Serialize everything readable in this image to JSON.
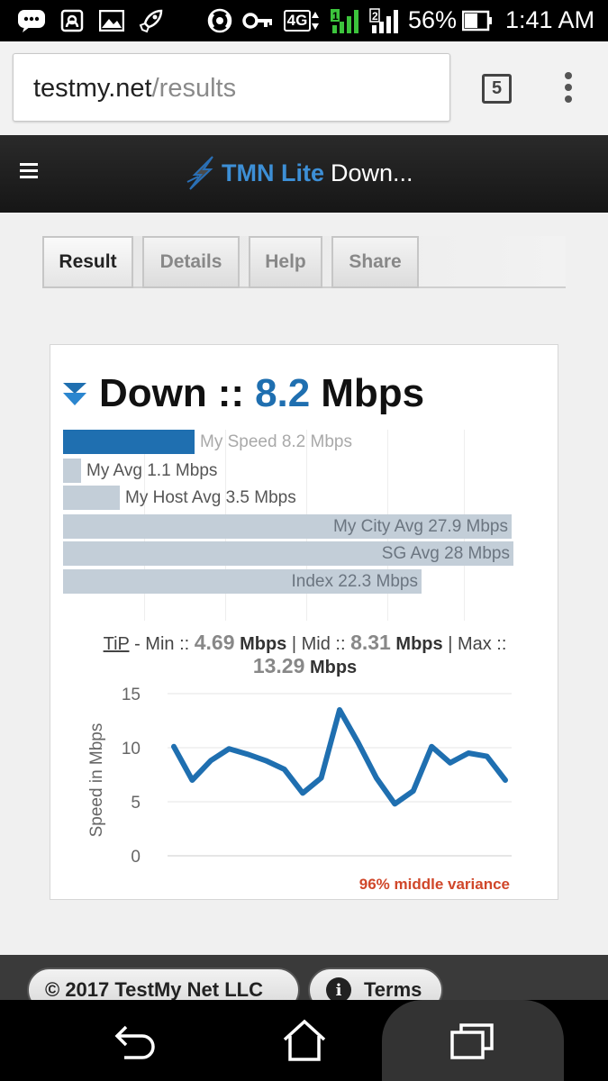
{
  "status_bar": {
    "battery": "56%",
    "time": "1:41 AM",
    "network": "4G",
    "sim2": "2"
  },
  "browser": {
    "url_host": "testmy.net",
    "url_path": "/results",
    "tab_count": "5"
  },
  "site_header": {
    "brand": "TMN Lite",
    "title_rest": "Down..."
  },
  "tabs": [
    {
      "label": "Result"
    },
    {
      "label": "Details"
    },
    {
      "label": "Help"
    },
    {
      "label": "Share"
    }
  ],
  "result": {
    "direction": "Down",
    "sep": "::",
    "speed": "8.2",
    "unit": "Mbps",
    "bars": [
      {
        "label": "My Speed 8.2 Mbps",
        "value": 8.2
      },
      {
        "label": "My Avg 1.1 Mbps",
        "value": 1.1
      },
      {
        "label": "My Host Avg 3.5 Mbps",
        "value": 3.5
      },
      {
        "label": "My City Avg 27.9 Mbps",
        "value": 27.9
      },
      {
        "label": "SG Avg 28 Mbps",
        "value": 28
      },
      {
        "label": "Index 22.3 Mbps",
        "value": 22.3
      }
    ],
    "tip": {
      "tip_label": "TiP",
      "min_label": "- Min ::",
      "min": "4.69",
      "mid_label": "| Mid ::",
      "mid": "8.31",
      "max_label": "| Max ::",
      "max": "13.29",
      "unit": "Mbps"
    },
    "variance": "96% middle variance"
  },
  "chart_data": {
    "type": "line",
    "ylabel": "Speed in Mbps",
    "ylim": [
      0,
      15
    ],
    "yticks": [
      0,
      5,
      10,
      15
    ],
    "grid": true,
    "series": [
      {
        "values": [
          10.1,
          7.0,
          8.8,
          9.9,
          9.4,
          8.8,
          8.0,
          5.8,
          7.2,
          13.5,
          10.5,
          7.2,
          4.8,
          6.0,
          10.1,
          8.6,
          9.5,
          9.2,
          7.0
        ]
      }
    ],
    "color": "#1f6fb0"
  },
  "footer": {
    "copyright": "© 2017 TestMy Net LLC",
    "terms": "Terms"
  }
}
